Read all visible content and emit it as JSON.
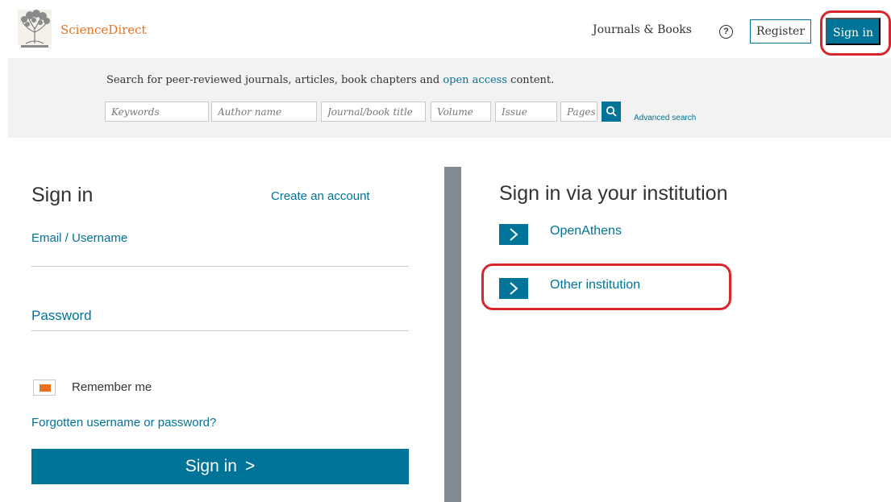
{
  "header": {
    "brand": "ScienceDirect",
    "nav_journals": "Journals & Books",
    "help_glyph": "?",
    "register_label": "Register",
    "signin_label": "Sign in"
  },
  "search": {
    "description_prefix": "Search for peer-reviewed journals, articles, book chapters and ",
    "description_link": "open access",
    "description_suffix": " content.",
    "keywords_placeholder": "Keywords",
    "author_placeholder": "Author name",
    "journal_placeholder": "Journal/book title",
    "volume_placeholder": "Volume",
    "issue_placeholder": "Issue",
    "pages_placeholder": "Pages",
    "advanced_label": "Advanced search"
  },
  "signin_form": {
    "title": "Sign in",
    "create_account": "Create an account",
    "email_label": "Email / Username",
    "email_value": "",
    "password_label": "Password",
    "password_value": "",
    "remember_label": "Remember me",
    "forgot_label": "Forgotten username or password?",
    "submit_label": "Sign in",
    "submit_chevron": ">"
  },
  "institution": {
    "title": "Sign in via your institution",
    "options": [
      {
        "label": "OpenAthens"
      },
      {
        "label": "Other institution"
      }
    ]
  },
  "icons": {
    "logo": "elsevier-tree-logo",
    "help": "question-circle-icon",
    "search": "magnifier-icon",
    "chevron": "chevron-right-icon"
  },
  "colors": {
    "brand_orange": "#e9711c",
    "primary_blue": "#007398",
    "annotation_red": "#d8262c",
    "divider_gray": "#808c91"
  }
}
